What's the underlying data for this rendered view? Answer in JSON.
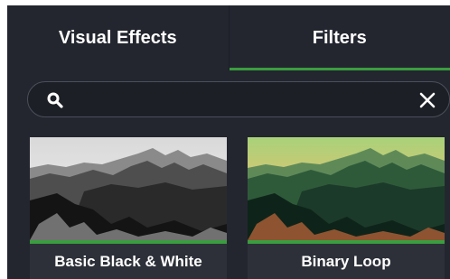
{
  "tabs": [
    {
      "label": "Visual Effects",
      "active": false
    },
    {
      "label": "Filters",
      "active": true
    }
  ],
  "search": {
    "value": "",
    "placeholder": "",
    "search_icon": "search-icon",
    "clear_icon": "close-icon"
  },
  "filters": [
    {
      "name": "Basic Black & White"
    },
    {
      "name": "Binary Loop"
    }
  ],
  "colors": {
    "panel_bg": "#23262f",
    "accent": "#3a9d3f",
    "text": "#ffffff"
  }
}
